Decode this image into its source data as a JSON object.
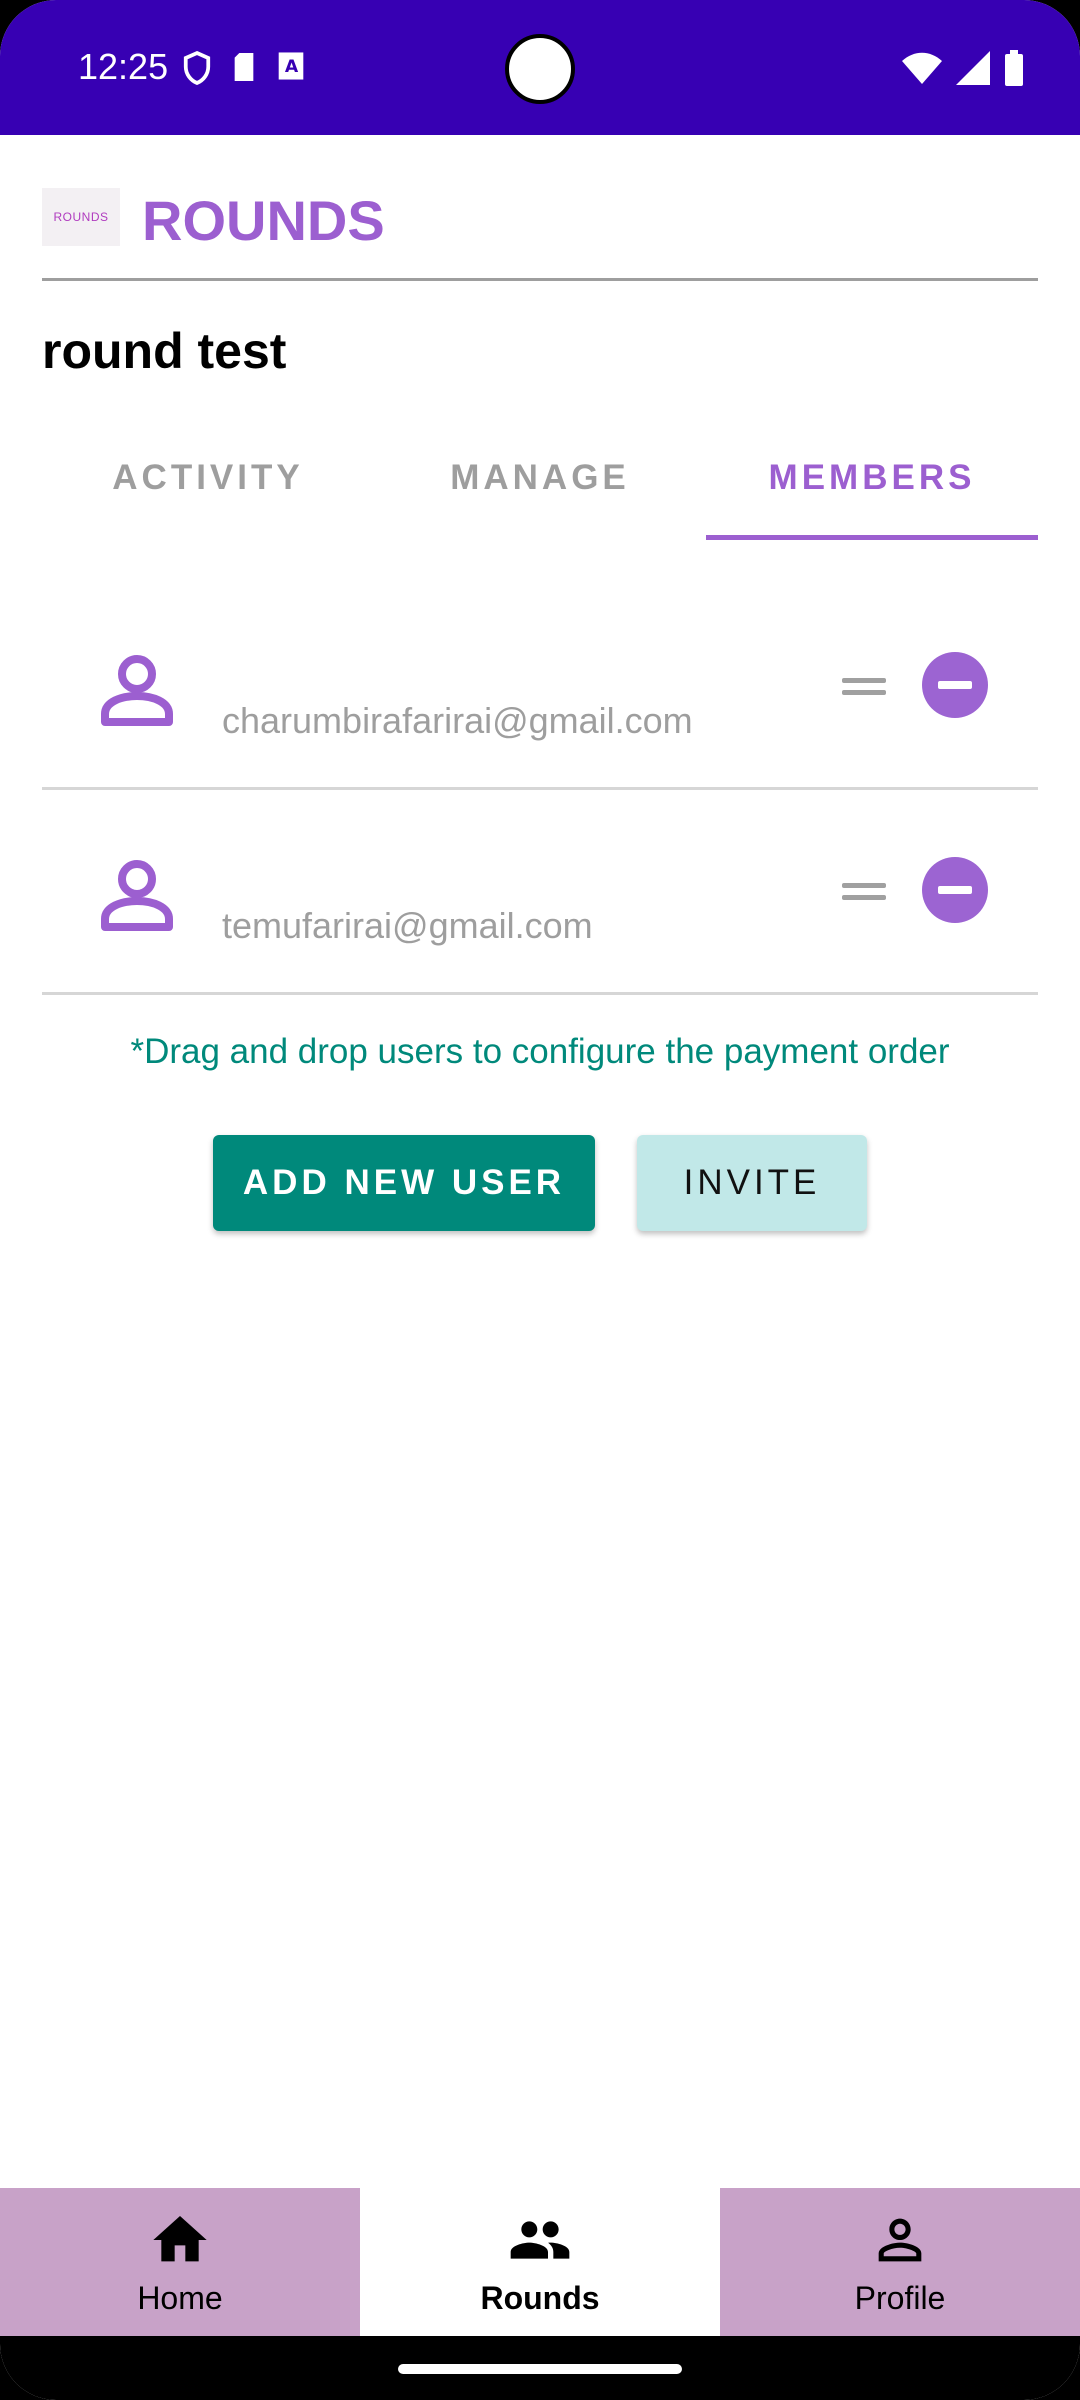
{
  "status_bar": {
    "time": "12:25",
    "left_icons": [
      "shield-icon",
      "sd-card-icon",
      "keyboard-icon"
    ],
    "right_icons": [
      "wifi-icon",
      "signal-icon",
      "battery-icon"
    ]
  },
  "header": {
    "logo_text": "ROUNDS",
    "title": "ROUNDS"
  },
  "round": {
    "name": "round test"
  },
  "tabs": [
    {
      "label": "ACTIVITY",
      "active": false
    },
    {
      "label": "MANAGE",
      "active": false
    },
    {
      "label": "MEMBERS",
      "active": true
    }
  ],
  "members": [
    {
      "email": "charumbirafarirai@gmail.com"
    },
    {
      "email": "temufarirai@gmail.com"
    }
  ],
  "hint": "*Drag and drop users to configure the payment order",
  "buttons": {
    "add_new_user": "ADD NEW USER",
    "invite": "INVITE"
  },
  "bottom_nav": [
    {
      "label": "Home",
      "icon": "home-icon",
      "active": false
    },
    {
      "label": "Rounds",
      "icon": "group-icon",
      "active": true
    },
    {
      "label": "Profile",
      "icon": "person-icon",
      "active": false
    }
  ],
  "colors": {
    "status_bar": "#3700b3",
    "accent_purple": "#9c5fd0",
    "teal": "#00897b",
    "light_teal": "#c1e8e8",
    "nav_lilac": "#c8a2c8"
  }
}
